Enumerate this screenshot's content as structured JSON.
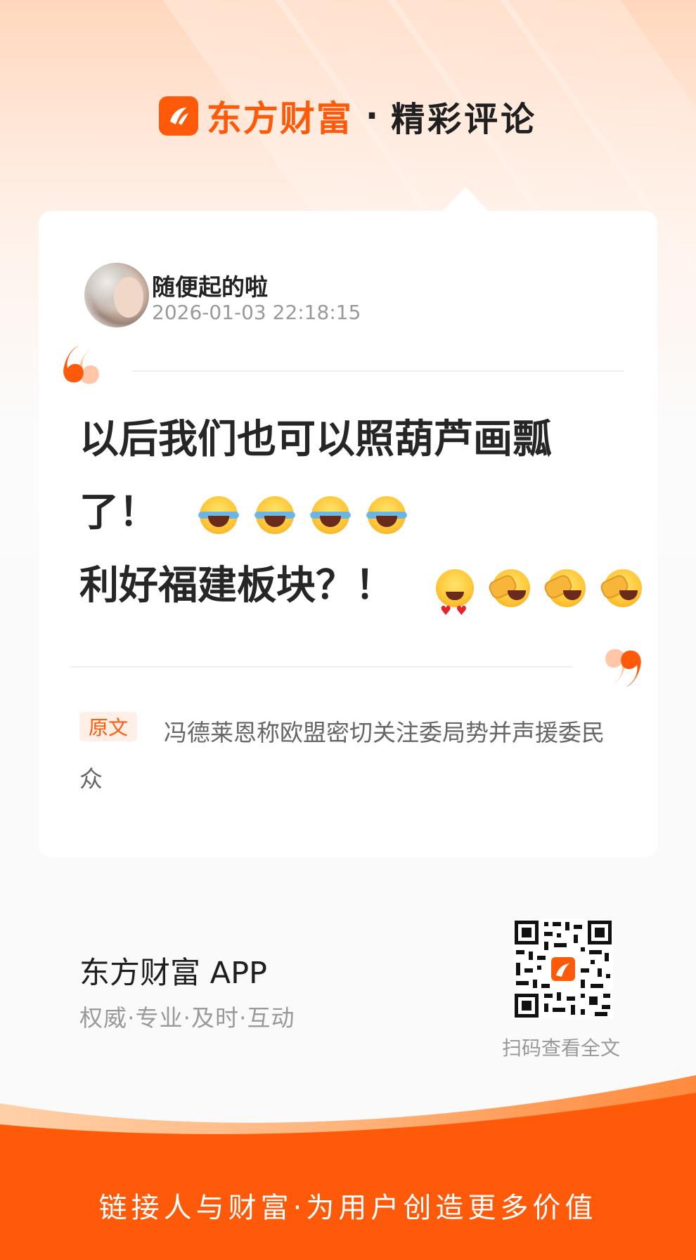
{
  "header": {
    "brand": "东方财富",
    "separator": "·",
    "title": "精彩评论"
  },
  "comment": {
    "username": "随便起的啦",
    "timestamp": "2026-01-03 22:18:15",
    "line1": "以后我们也可以照葫芦画瓢",
    "line2": "了！",
    "line3": "利好福建板块？！",
    "line2_emojis": [
      "face-with-tears-of-joy",
      "face-with-tears-of-joy",
      "face-with-tears-of-joy",
      "face-with-tears-of-joy"
    ],
    "line3_emojis": [
      "smiling-face-with-heart-eyes",
      "loudly-crying-face",
      "loudly-crying-face",
      "loudly-crying-face"
    ]
  },
  "original": {
    "badge": "原文",
    "text": "冯德莱恩称欧盟密切关注委局势并声援委民众"
  },
  "promo": {
    "app_name": "东方财富 APP",
    "slogan": "权威·专业·及时·互动",
    "qr_caption": "扫码查看全文"
  },
  "footer": {
    "text": "链接人与财富·为用户创造更多价值"
  },
  "colors": {
    "brand_orange": "#ff5a0a",
    "quote_light": "#ffc7a8",
    "text_dark": "#262626",
    "text_muted": "#999999"
  }
}
